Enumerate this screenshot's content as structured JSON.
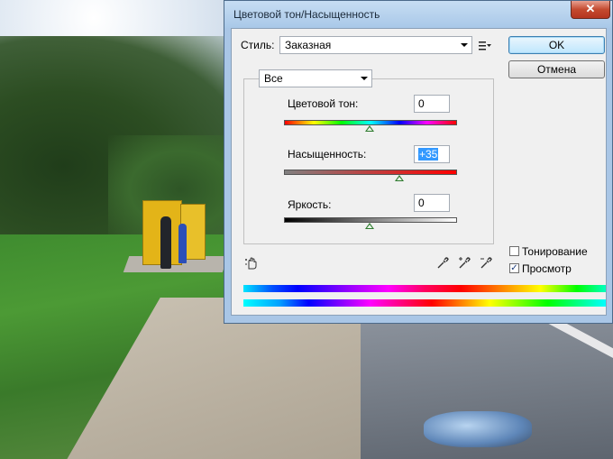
{
  "dialog": {
    "title": "Цветовой тон/Насыщенность",
    "close_glyph": "✕",
    "style_label": "Стиль:",
    "style_value": "Заказная",
    "channel_value": "Все",
    "ok_label": "OK",
    "cancel_label": "Отмена",
    "hue": {
      "label": "Цветовой тон:",
      "value": "0",
      "level": 0
    },
    "saturation": {
      "label": "Насыщенность:",
      "value": "+35",
      "level": 35
    },
    "lightness": {
      "label": "Яркость:",
      "value": "0",
      "level": 0
    },
    "colorize": {
      "label": "Тонирование",
      "checked": false
    },
    "preview": {
      "label": "Просмотр",
      "checked": true,
      "check_glyph": "✓"
    }
  },
  "icons": {
    "targeted_adjustment": "hand-icon",
    "eyedropper": "eyedropper-icon",
    "eyedropper_add": "eyedropper-plus-icon",
    "eyedropper_subtract": "eyedropper-minus-icon",
    "options_menu": "menu-icon"
  },
  "colors": {
    "titlebar": "#a9c8e8",
    "ok_button": "#bee6fd",
    "close_button": "#c44a30",
    "slider_thumb": "#2f7a2f"
  }
}
